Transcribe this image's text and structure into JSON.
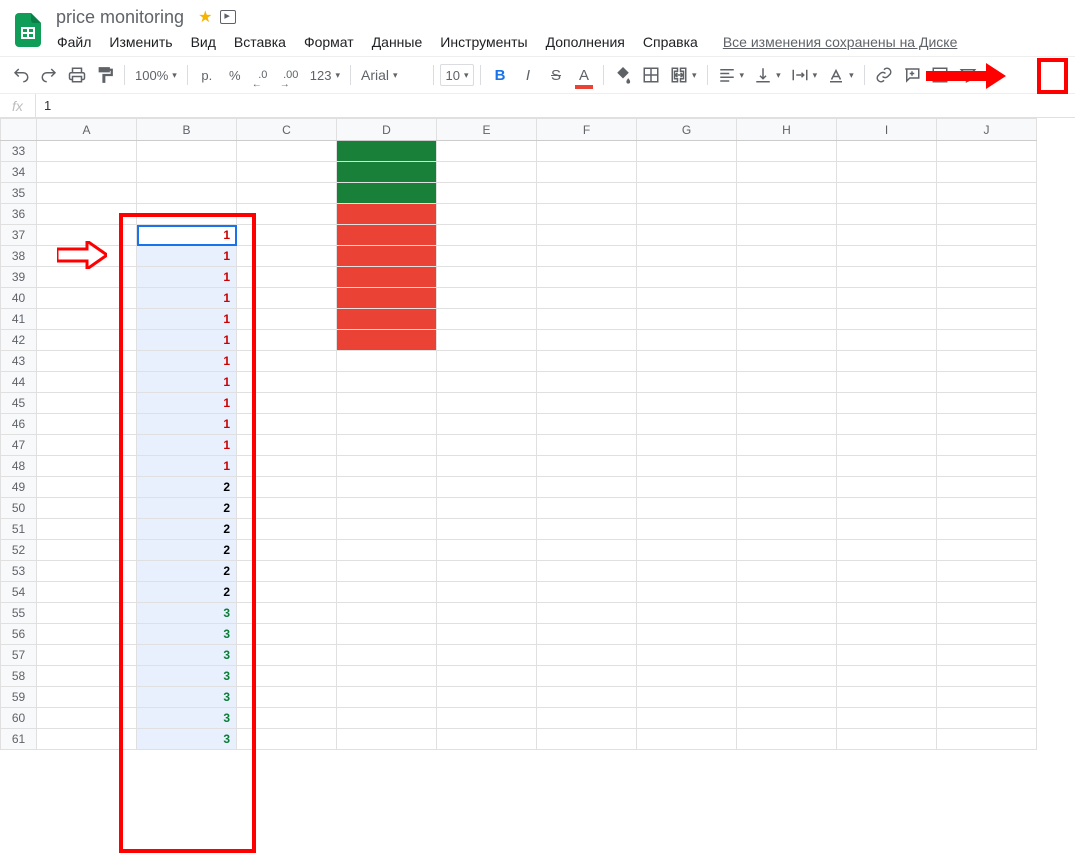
{
  "header": {
    "doc_title": "price monitoring",
    "menus": [
      "Файл",
      "Изменить",
      "Вид",
      "Вставка",
      "Формат",
      "Данные",
      "Инструменты",
      "Дополнения",
      "Справка"
    ],
    "save_status": "Все изменения сохранены на Диске"
  },
  "toolbar": {
    "zoom": "100%",
    "currency": "р.",
    "percent": "%",
    "dec_dec": ".0",
    "dec_inc": ".00",
    "number_format": "123",
    "font": "Arial",
    "font_size": "10",
    "bold": "B",
    "italic": "I",
    "strike": "S",
    "textcolor": "A"
  },
  "formula": {
    "fx": "fx",
    "value": "1"
  },
  "grid": {
    "columns": [
      "A",
      "B",
      "C",
      "D",
      "E",
      "F",
      "G",
      "H",
      "I",
      "J"
    ],
    "rows": [
      {
        "n": 33,
        "b": null,
        "d": "green"
      },
      {
        "n": 34,
        "b": null,
        "d": "green"
      },
      {
        "n": 35,
        "b": null,
        "d": "green"
      },
      {
        "n": 36,
        "b": null,
        "d": "red"
      },
      {
        "n": 37,
        "b": 1,
        "d": "red",
        "active": true
      },
      {
        "n": 38,
        "b": 1,
        "d": "red"
      },
      {
        "n": 39,
        "b": 1,
        "d": "red"
      },
      {
        "n": 40,
        "b": 1,
        "d": "red"
      },
      {
        "n": 41,
        "b": 1,
        "d": "red"
      },
      {
        "n": 42,
        "b": 1,
        "d": "red"
      },
      {
        "n": 43,
        "b": 1,
        "d": null
      },
      {
        "n": 44,
        "b": 1,
        "d": null
      },
      {
        "n": 45,
        "b": 1,
        "d": null
      },
      {
        "n": 46,
        "b": 1,
        "d": null
      },
      {
        "n": 47,
        "b": 1,
        "d": null
      },
      {
        "n": 48,
        "b": 1,
        "d": null
      },
      {
        "n": 49,
        "b": 2,
        "d": null
      },
      {
        "n": 50,
        "b": 2,
        "d": null
      },
      {
        "n": 51,
        "b": 2,
        "d": null
      },
      {
        "n": 52,
        "b": 2,
        "d": null
      },
      {
        "n": 53,
        "b": 2,
        "d": null
      },
      {
        "n": 54,
        "b": 2,
        "d": null
      },
      {
        "n": 55,
        "b": 3,
        "d": null
      },
      {
        "n": 56,
        "b": 3,
        "d": null
      },
      {
        "n": 57,
        "b": 3,
        "d": null
      },
      {
        "n": 58,
        "b": 3,
        "d": null
      },
      {
        "n": 59,
        "b": 3,
        "d": null
      },
      {
        "n": 60,
        "b": 3,
        "d": null
      },
      {
        "n": 61,
        "b": 3,
        "d": null
      }
    ]
  }
}
